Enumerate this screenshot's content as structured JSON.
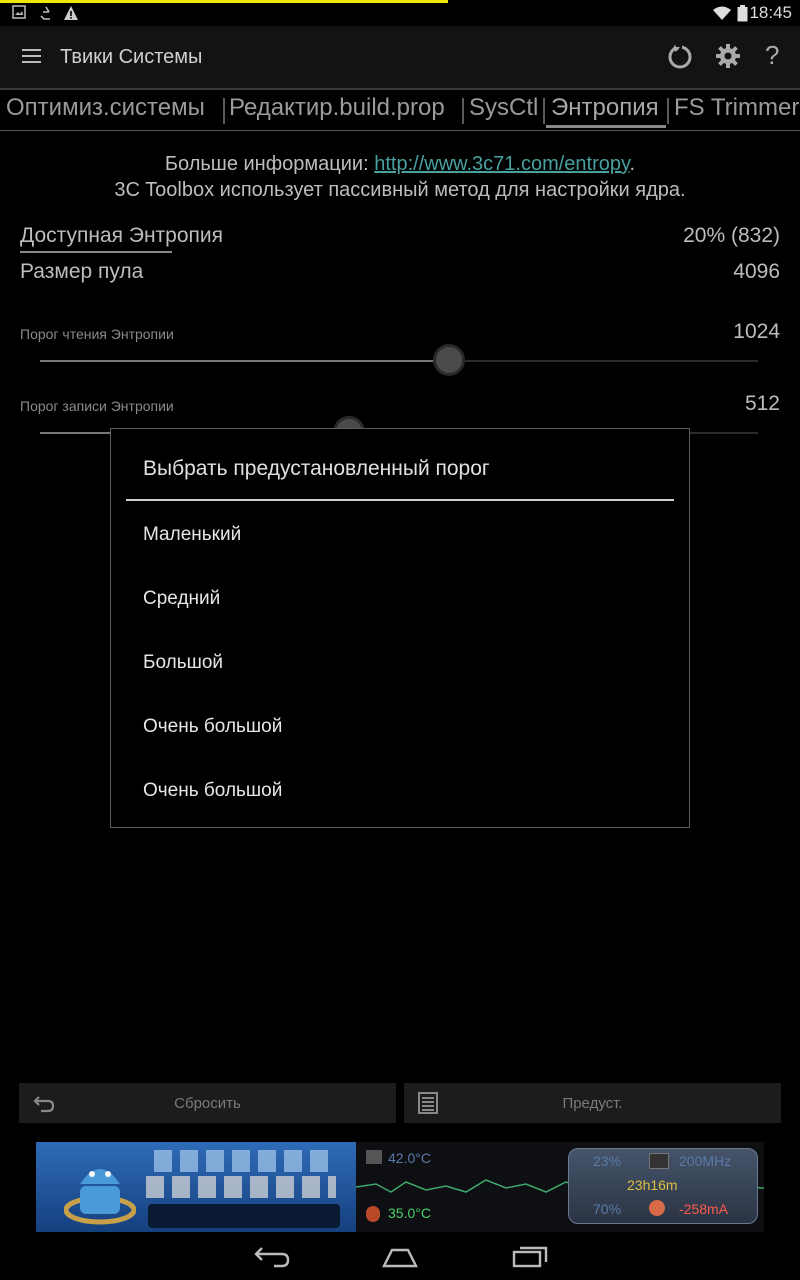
{
  "status_bar": {
    "time": "18:45",
    "icons": [
      "image-icon",
      "recycle-icon",
      "warning-icon",
      "wifi-icon",
      "battery-icon"
    ]
  },
  "action_bar": {
    "title": "Твики Системы",
    "icons": [
      "menu-icon",
      "reboot-icon",
      "settings-icon",
      "help-icon"
    ]
  },
  "tabs": [
    {
      "label": "Оптимиз.системы",
      "active": false
    },
    {
      "label": "Редактир.build.prop",
      "active": false
    },
    {
      "label": "SysCtl",
      "active": false
    },
    {
      "label": "Энтропия",
      "active": true
    },
    {
      "label": "FS Trimmer",
      "active": false
    }
  ],
  "info": {
    "more_prefix": "Больше информации: ",
    "link": "http://www.3c71.com/entropy",
    "link_suffix": ".",
    "line2": "3C Toolbox использует пассивный метод для настройки ядра."
  },
  "available_entropy": {
    "label": "Доступная Энтропия",
    "value": "20% (832)"
  },
  "pool_size": {
    "label": "Размер пула",
    "value": "4096"
  },
  "read_threshold": {
    "label": "Порог чтения Энтропии",
    "value": "1024",
    "level": 0.57
  },
  "write_threshold": {
    "label": "Порог записи Энтропии",
    "value": "512",
    "level": 0.43
  },
  "dialog": {
    "title": "Выбрать предустановленный порог",
    "options": [
      "Маленький",
      "Средний",
      "Большой",
      "Очень большой",
      "Очень большой"
    ]
  },
  "buttons": {
    "reset": "Сбросить",
    "presets": "Предуст."
  },
  "ad": {
    "temp1": "42.0°C",
    "temp2": "35.0°C",
    "percent1": "23%",
    "freq": "200MHz",
    "uptime": "23h16m",
    "percent2": "70%",
    "current": "-258mA"
  },
  "colors": {
    "accent_yellow": "#f2e500",
    "link": "#4aa0a0",
    "ad_blue": "#1a3f7a",
    "ad_red": "#ff5a4a",
    "ad_green": "#4ccf6a"
  }
}
